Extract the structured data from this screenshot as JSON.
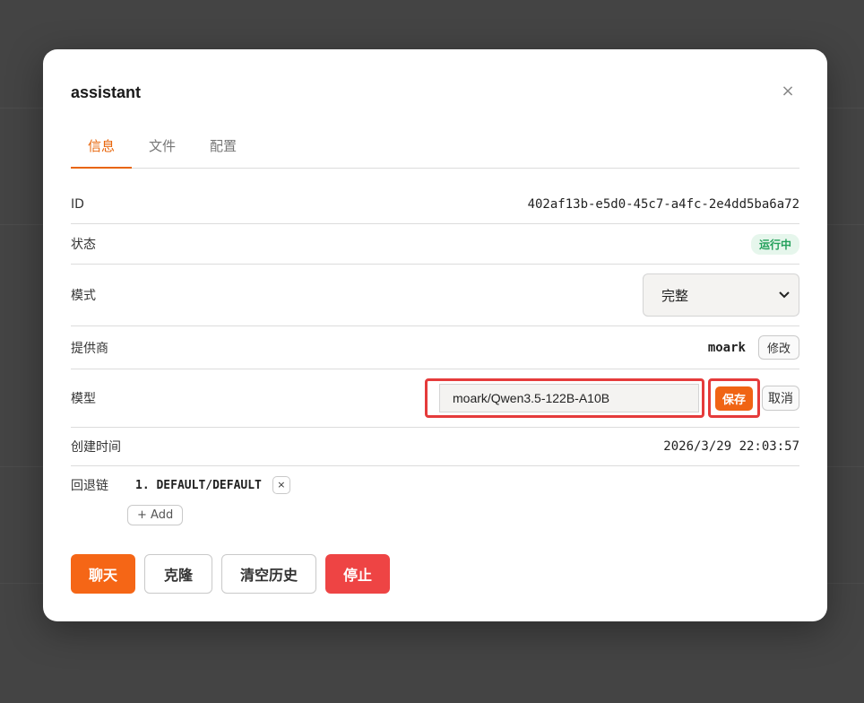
{
  "dialog": {
    "title": "assistant",
    "close_glyph": "×"
  },
  "tabs": [
    {
      "label": "信息",
      "active": true
    },
    {
      "label": "文件",
      "active": false
    },
    {
      "label": "配置",
      "active": false
    }
  ],
  "info": {
    "id": {
      "label": "ID",
      "value": "402af13b-e5d0-45c7-a4fc-2e4dd5ba6a72"
    },
    "status": {
      "label": "状态",
      "value": "运行中"
    },
    "mode": {
      "label": "模式",
      "value": "完整"
    },
    "provider": {
      "label": "提供商",
      "value": "moark",
      "edit_label": "修改"
    },
    "model": {
      "label": "模型",
      "value": "moark/Qwen3.5-122B-A10B",
      "save_label": "保存",
      "cancel_label": "取消"
    },
    "created": {
      "label": "创建时间",
      "value": "2026/3/29 22:03:57"
    },
    "fallback": {
      "label": "回退链",
      "items": [
        "1. DEFAULT/DEFAULT"
      ],
      "remove_glyph": "×",
      "add_label": "+ Add"
    }
  },
  "actions": {
    "chat": "聊天",
    "clone": "克隆",
    "clear_history": "清空历史",
    "stop": "停止"
  },
  "colors": {
    "accent": "#e8650a",
    "danger": "#ee4444",
    "success": "#22a05a",
    "highlight": "#e53b3b"
  }
}
